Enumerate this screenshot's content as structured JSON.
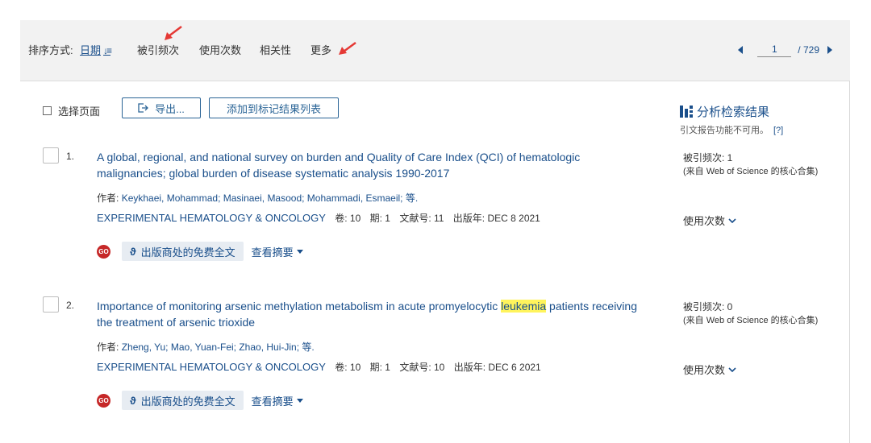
{
  "sortbar": {
    "label": "排序方式:",
    "options": [
      "日期",
      "被引频次",
      "使用次数",
      "相关性",
      "更多"
    ],
    "active_indicator": "↓≡"
  },
  "pager": {
    "current": "1",
    "total": "/ 729"
  },
  "toolbar": {
    "select_page": "选择页面",
    "export": "导出...",
    "add_to_marked": "添加到标记结果列表"
  },
  "analyze": {
    "title": "分析检索结果",
    "note": "引文报告功能不可用。",
    "help": "[?]"
  },
  "records": [
    {
      "num": "1.",
      "title": "A global, regional, and national survey on burden and Quality of Care Index (QCI) of hematologic malignancies; global burden of disease systematic analysis 1990-2017",
      "authors_label": "作者:",
      "authors": "Keykhaei, Mohammad; Masinaei, Masood; Mohammadi, Esmaeil; 等.",
      "journal": "EXPERIMENTAL HEMATOLOGY & ONCOLOGY",
      "volume": "卷: 10",
      "issue": "期: 1",
      "article": "文献号: 11",
      "year": "出版年: DEC 8 2021",
      "fulltext": "出版商处的免费全文",
      "abstract": "查看摘要",
      "cited": "被引频次: 1",
      "cited_source": "(来自 Web of Science 的核心合集)",
      "usage": "使用次数"
    },
    {
      "num": "2.",
      "title_before": "Importance of monitoring arsenic methylation metabolism in acute promyelocytic ",
      "title_highlight": "leukemia",
      "title_after": " patients receiving the treatment of arsenic trioxide",
      "authors_label": "作者:",
      "authors": "Zheng, Yu; Mao, Yuan-Fei; Zhao, Hui-Jin; 等.",
      "journal": "EXPERIMENTAL HEMATOLOGY & ONCOLOGY",
      "volume": "卷: 10",
      "issue": "期: 1",
      "article": "文献号: 10",
      "year": "出版年: DEC 6 2021",
      "fulltext": "出版商处的免费全文",
      "abstract": "查看摘要",
      "cited": "被引频次: 0",
      "cited_source": "(来自 Web of Science 的核心合集)",
      "usage": "使用次数"
    }
  ],
  "colors": {
    "link": "#1a4f8b",
    "highlight": "#fff45c",
    "annotation_arrow": "#e53935",
    "sortbar_bg": "#f2f2f2"
  },
  "icons": [
    "sort-desc-icon",
    "red-arrow-annotation",
    "page-prev-icon",
    "page-next-icon",
    "export-icon",
    "bar-chart-icon",
    "go-icon",
    "open-access-icon",
    "caret-down-icon",
    "chevron-down-icon"
  ]
}
